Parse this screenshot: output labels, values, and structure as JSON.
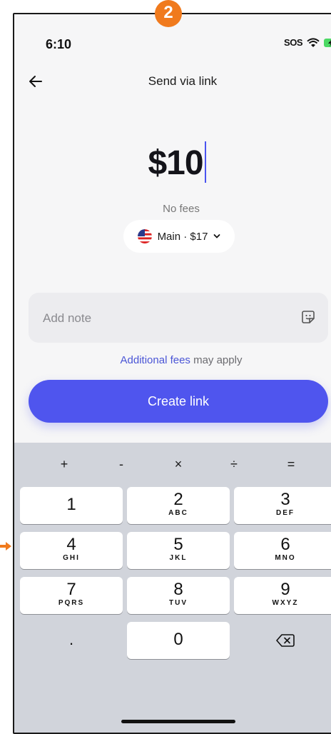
{
  "badge": {
    "step": "2"
  },
  "status_bar": {
    "time": "6:10",
    "sos": "SOS"
  },
  "nav": {
    "title": "Send via link"
  },
  "amount": {
    "value": "$10",
    "fees_text": "No fees"
  },
  "account": {
    "label": "Main · $17"
  },
  "note": {
    "placeholder": "Add note"
  },
  "fees_notice": {
    "link": "Additional fees",
    "rest": " may apply"
  },
  "create_button": {
    "label": "Create link"
  },
  "keyboard": {
    "operators": [
      "+",
      "-",
      "×",
      "÷",
      "="
    ],
    "keys": [
      {
        "digit": "1",
        "letters": ""
      },
      {
        "digit": "2",
        "letters": "ABC"
      },
      {
        "digit": "3",
        "letters": "DEF"
      },
      {
        "digit": "4",
        "letters": "GHI"
      },
      {
        "digit": "5",
        "letters": "JKL"
      },
      {
        "digit": "6",
        "letters": "MNO"
      },
      {
        "digit": "7",
        "letters": "PQRS"
      },
      {
        "digit": "8",
        "letters": "TUV"
      },
      {
        "digit": "9",
        "letters": "WXYZ"
      },
      {
        "digit": "0",
        "letters": ""
      }
    ],
    "decimal": "."
  },
  "colors": {
    "accent": "#4f55ee",
    "badge": "#f07a1d",
    "keyboard_bg": "#d1d4db"
  }
}
